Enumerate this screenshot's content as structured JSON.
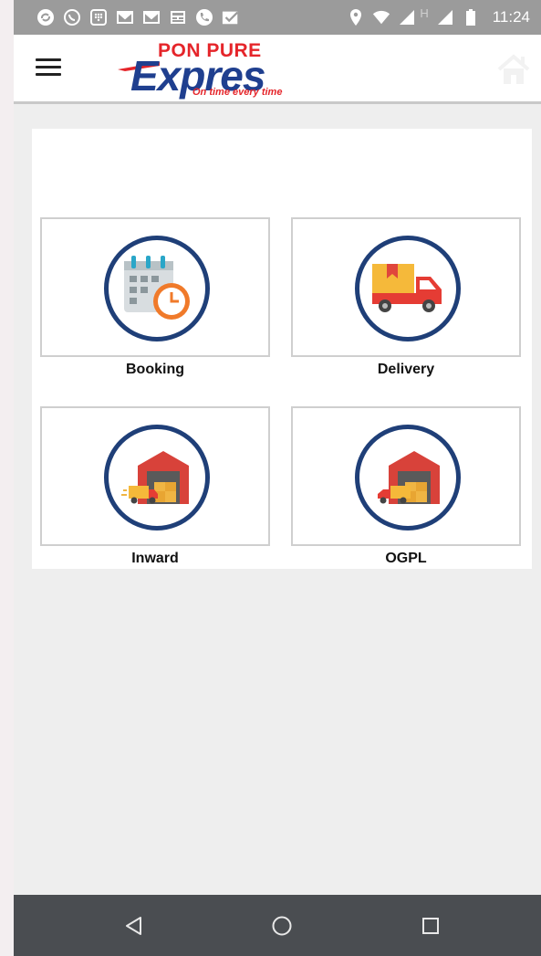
{
  "status_bar": {
    "time": "11:24",
    "notification_icons": [
      "sync-icon",
      "whatsapp-icon",
      "grid-icon",
      "gmail-icon",
      "gmail-icon",
      "news-icon",
      "phone-icon",
      "check-icon"
    ],
    "system_icons": [
      "location-icon",
      "wifi-icon",
      "signal-icon",
      "signal-icon",
      "battery-icon"
    ],
    "network_label": "H"
  },
  "app_bar": {
    "logo_top": "PON PURE",
    "logo_main": "Expres",
    "logo_sub": "On time every time"
  },
  "tiles": [
    {
      "label": "Booking",
      "icon": "booking-calendar-icon"
    },
    {
      "label": "Delivery",
      "icon": "delivery-truck-icon"
    },
    {
      "label": "Inward",
      "icon": "inward-warehouse-icon"
    },
    {
      "label": "OGPL",
      "icon": "ogpl-warehouse-icon"
    }
  ],
  "colors": {
    "circle_border": "#1f3f78",
    "logo_blue": "#1f3f8f",
    "logo_red": "#e5252a",
    "status_bar": "#9b9b9b",
    "nav_bar": "#4a4d51"
  }
}
